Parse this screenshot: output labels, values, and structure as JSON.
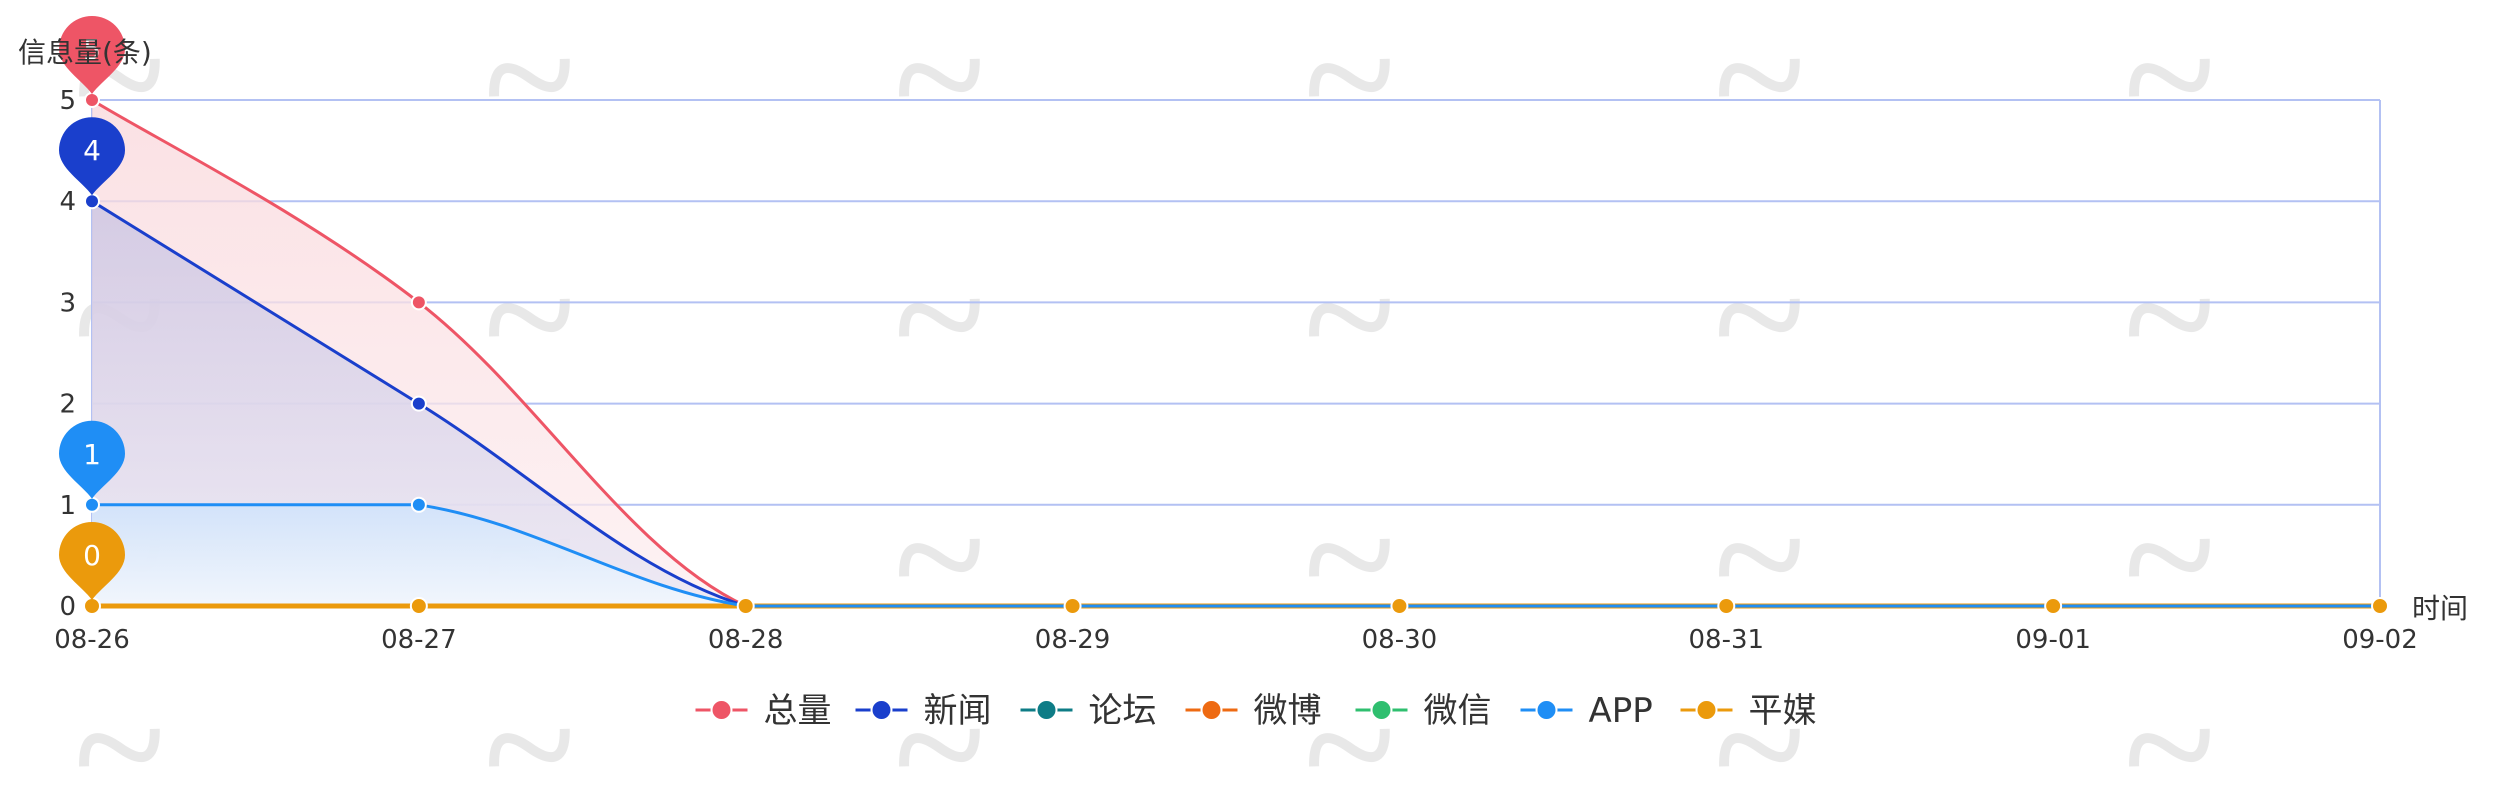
{
  "chart_data": {
    "type": "line",
    "ylabel": "信息量(条)",
    "xlabel": "时间",
    "ylim": [
      0,
      5
    ],
    "yticks": [
      "0",
      "1",
      "2",
      "3",
      "4",
      "5"
    ],
    "categories": [
      "08-26",
      "08-27",
      "08-28",
      "08-29",
      "08-30",
      "08-31",
      "09-01",
      "09-02"
    ],
    "series": [
      {
        "name": "总量",
        "color": "#ee5566",
        "values": [
          5,
          3,
          0,
          0,
          0,
          0,
          0,
          0
        ]
      },
      {
        "name": "新闻",
        "color": "#1a3fcc",
        "values": [
          4,
          2,
          0,
          0,
          0,
          0,
          0,
          0
        ]
      },
      {
        "name": "论坛",
        "color": "#0e7c86",
        "values": [
          0,
          0,
          0,
          0,
          0,
          0,
          0,
          0
        ]
      },
      {
        "name": "微博",
        "color": "#ee6a12",
        "values": [
          0,
          0,
          0,
          0,
          0,
          0,
          0,
          0
        ]
      },
      {
        "name": "微信",
        "color": "#2fbf6f",
        "values": [
          0,
          0,
          0,
          0,
          0,
          0,
          0,
          0
        ]
      },
      {
        "name": "APP",
        "color": "#1f8ef5",
        "values": [
          1,
          1,
          0,
          0,
          0,
          0,
          0,
          0
        ]
      },
      {
        "name": "平媒",
        "color": "#eb9a0c",
        "values": [
          0,
          0,
          0,
          0,
          0,
          0,
          0,
          0
        ]
      }
    ],
    "markers": [
      {
        "series": "总量",
        "label": "5"
      },
      {
        "series": "新闻",
        "label": "4"
      },
      {
        "series": "APP",
        "label": "1"
      },
      {
        "series": "平媒",
        "label": "0"
      }
    ],
    "grid": true,
    "legend": "bottom-center"
  }
}
